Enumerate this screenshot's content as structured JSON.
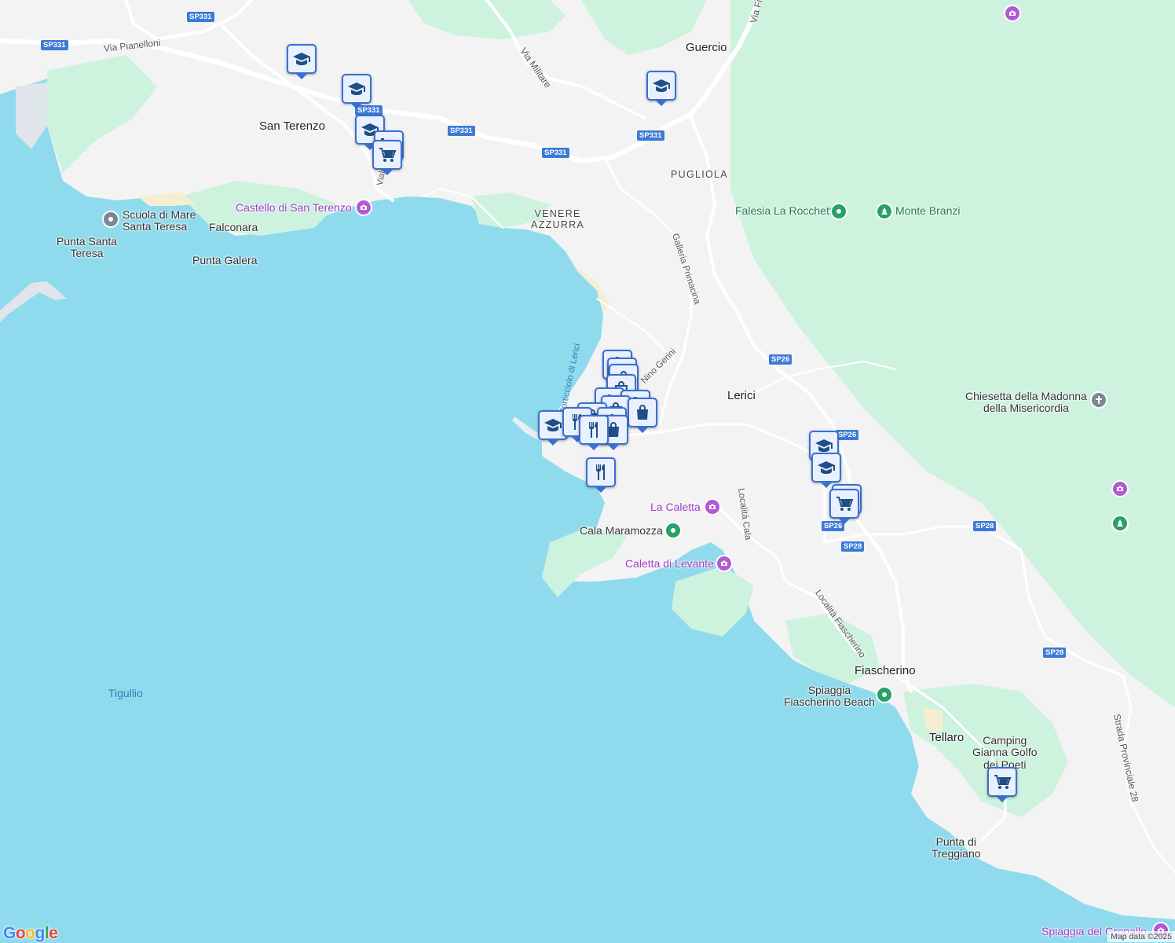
{
  "map": {
    "colors": {
      "water": "#8fdbed",
      "land": "#f3f3f4",
      "park": "#cdf2dd",
      "road": "#ffffff",
      "highway_shield": "#3c7ad6",
      "marker": "#3b6fcf",
      "poi_purple": "#b15ad1",
      "poi_green": "#27a166"
    },
    "labels": {
      "via_pianelloni": "Via Pianelloni",
      "via_militare": "Via Militare",
      "guercio": "Guercio",
      "via_fi": "Via Fi",
      "san_terenzo": "San Terenzo",
      "pugliola": "PUGLIOLA",
      "venere_azzurra": "VENERE\nAZZURRA",
      "castello": "Castello di San Terenzo",
      "falconara": "Falconara",
      "scuola_di_mare": "Scuola di Mare\nSanta Teresa",
      "punta_santa_teresa": "Punta Santa\nTeresa",
      "punta_galera": "Punta Galera",
      "falesia": "Falesia La Rocchetta",
      "monte_branzi": "Monte Branzi",
      "galleria_primacina": "Galleria Primacina",
      "nino_gerini": "Nino Gerini",
      "molo": "Porticciolo di Lerici",
      "lerici": "Lerici",
      "chiesetta": "Chiesetta della Madonna\ndella Misericordia",
      "la_caletta": "La Caletta",
      "cala_maramozza": "Cala Maramozza",
      "localita_cala": "Località Cala",
      "caletta_di_levante": "Caletta di Levante",
      "localita_fiascherino": "Località Fiascherino",
      "fiascherino": "Fiascherino",
      "spiaggia_fiascherino": "Spiaggia\nFiascherino Beach",
      "tigullio": "Tigullio",
      "tellaro": "Tellaro",
      "camping": "Camping\nGianna Golfo\ndei Poeti",
      "punta_di_treggiano": "Punta di\nTreggiano",
      "strada_provinciale_28": "Strada Provinciale 28",
      "spiaggia_del_gropallo": "Spiaggia del Gropallo",
      "viale": "Viale"
    },
    "shields": [
      "SP331",
      "SP331",
      "SP331",
      "SP331",
      "SP331",
      "SP26",
      "SP26",
      "SP26",
      "SP28",
      "SP28",
      "SP28"
    ],
    "attribution": "Map data ©2025",
    "logo": "Google"
  }
}
